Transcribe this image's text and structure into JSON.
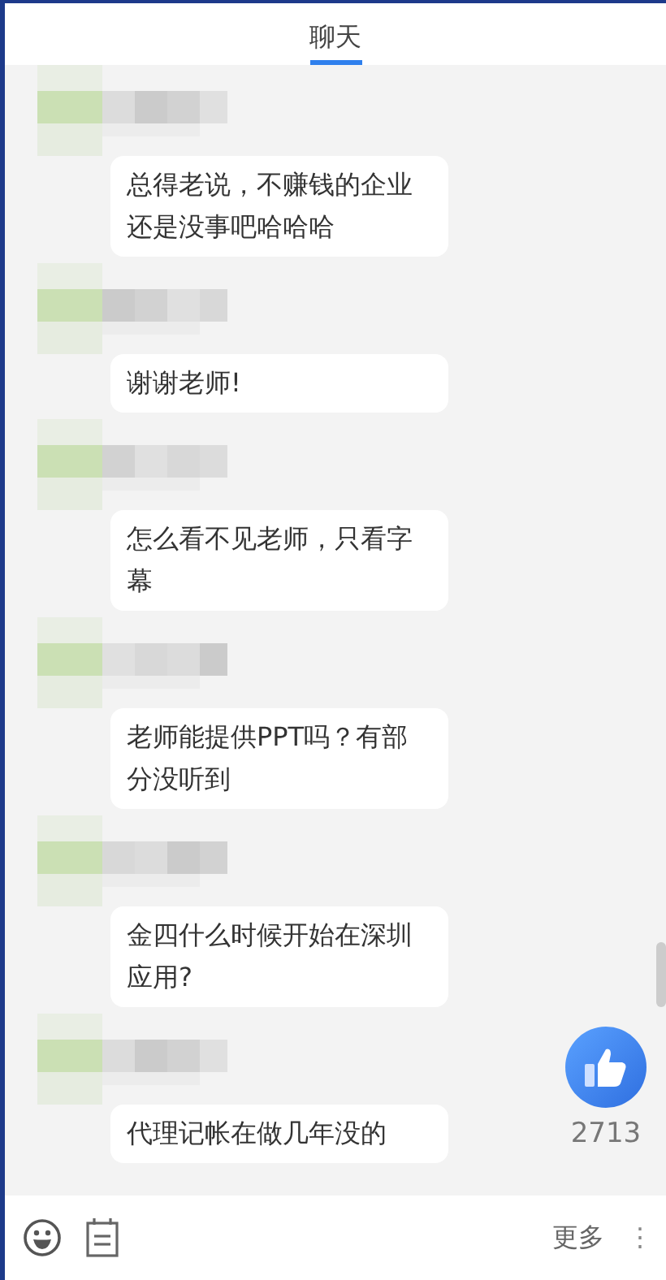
{
  "header": {
    "tabs": [
      {
        "label": "聊天",
        "selected": true
      }
    ]
  },
  "messages": [
    {
      "text": "总得老说，不赚钱的企业还是没事吧哈哈哈"
    },
    {
      "text": "谢谢老师!"
    },
    {
      "text": "怎么看不见老师，只看字幕"
    },
    {
      "text": "老师能提供PPT吗？有部分没听到"
    },
    {
      "text": "金四什么时候开始在深圳应用?"
    },
    {
      "text": "代理记帐在做几年没的"
    }
  ],
  "like": {
    "count": "2713"
  },
  "footer": {
    "more_label": "更多",
    "more_icon": "⋮"
  }
}
